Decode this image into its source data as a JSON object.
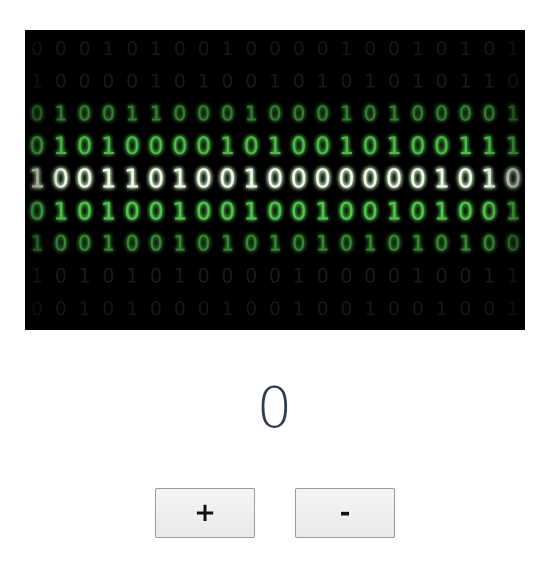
{
  "hero_image": {
    "kind": "binary-code-illustration",
    "background_color": "#000000",
    "digit_color": "#5fe35a",
    "glow_color": "#3dff3a",
    "rows": [
      "000101001000010010101",
      "100001010010101010110",
      "010011000100010100001",
      "010100001010010100111",
      "100110100100000001010",
      "010100100100100101001",
      "100100101010101010100",
      "101010100001000010011",
      "001010001001001001001"
    ],
    "row_intensity": [
      0.1,
      0.13,
      0.32,
      0.72,
      1.0,
      0.8,
      0.38,
      0.14,
      0.1
    ]
  },
  "counter": {
    "value": "0"
  },
  "buttons": {
    "increment_label": "+",
    "decrement_label": "-"
  }
}
